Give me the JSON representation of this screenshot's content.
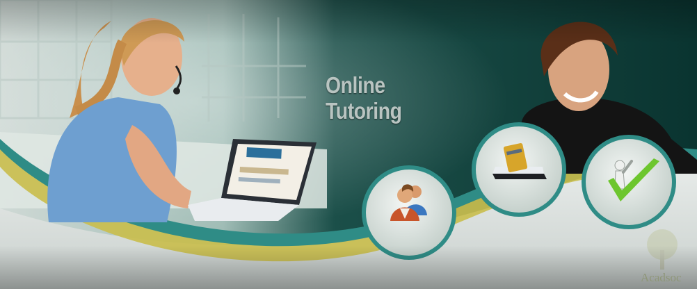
{
  "banner": {
    "headline_line1": "Online",
    "headline_line2": "Tutoring",
    "watermark": "Acadsoc"
  },
  "features": [
    {
      "icon": "students-icon"
    },
    {
      "icon": "payment-tablet-icon"
    },
    {
      "icon": "success-checkmark-icon"
    }
  ],
  "colors": {
    "background_teal": "#0f4a43",
    "swoosh_yellow": "#c9be4e",
    "swoosh_teal": "#2f8c86",
    "circle_fill": "#dfe6e3",
    "headline_text": "#b9c4c1",
    "check_green": "#6dc62e"
  }
}
